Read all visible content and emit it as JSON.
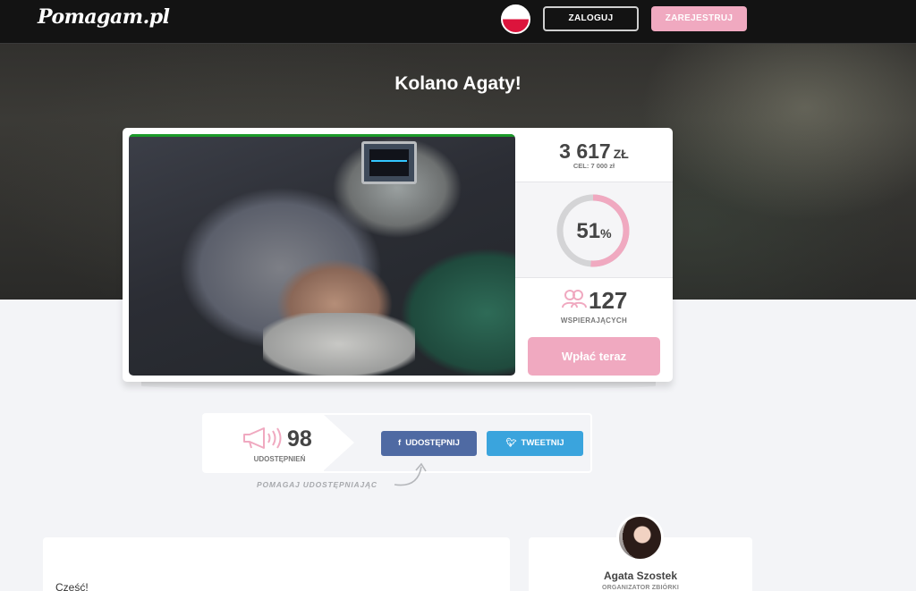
{
  "header": {
    "logo": "Pomagam.pl",
    "language_flag": "poland-flag-icon",
    "login_label": "ZALOGUJ",
    "register_label": "ZAREJESTRUJ"
  },
  "campaign": {
    "title": "Kolano Agaty!",
    "amount": "3 617",
    "currency": "ZŁ",
    "goal": "CEL: 7 000 zł",
    "progress_percent": 51,
    "progress_value": "51",
    "progress_unit": "%",
    "supporters_count": "127",
    "supporters_label": "WSPIERAJĄCYCH",
    "donate_label": "Wpłać teraz"
  },
  "share": {
    "count": "98",
    "label": "UDOSTĘPNIEŃ",
    "facebook_label": "UDOSTĘPNIJ",
    "twitter_label": "TWEETNIJ",
    "hint": "POMAGAJ UDOSTĘPNIAJĄC"
  },
  "story": {
    "greeting": "Cześć!"
  },
  "organizer": {
    "name": "Agata Szostek",
    "role": "ORGANIZATOR ZBIÓRKI"
  },
  "colors": {
    "accent_pink": "#f0a9c0",
    "facebook_blue": "#4f6aa3",
    "twitter_blue": "#3aa4dd",
    "topbar": "#131313"
  }
}
